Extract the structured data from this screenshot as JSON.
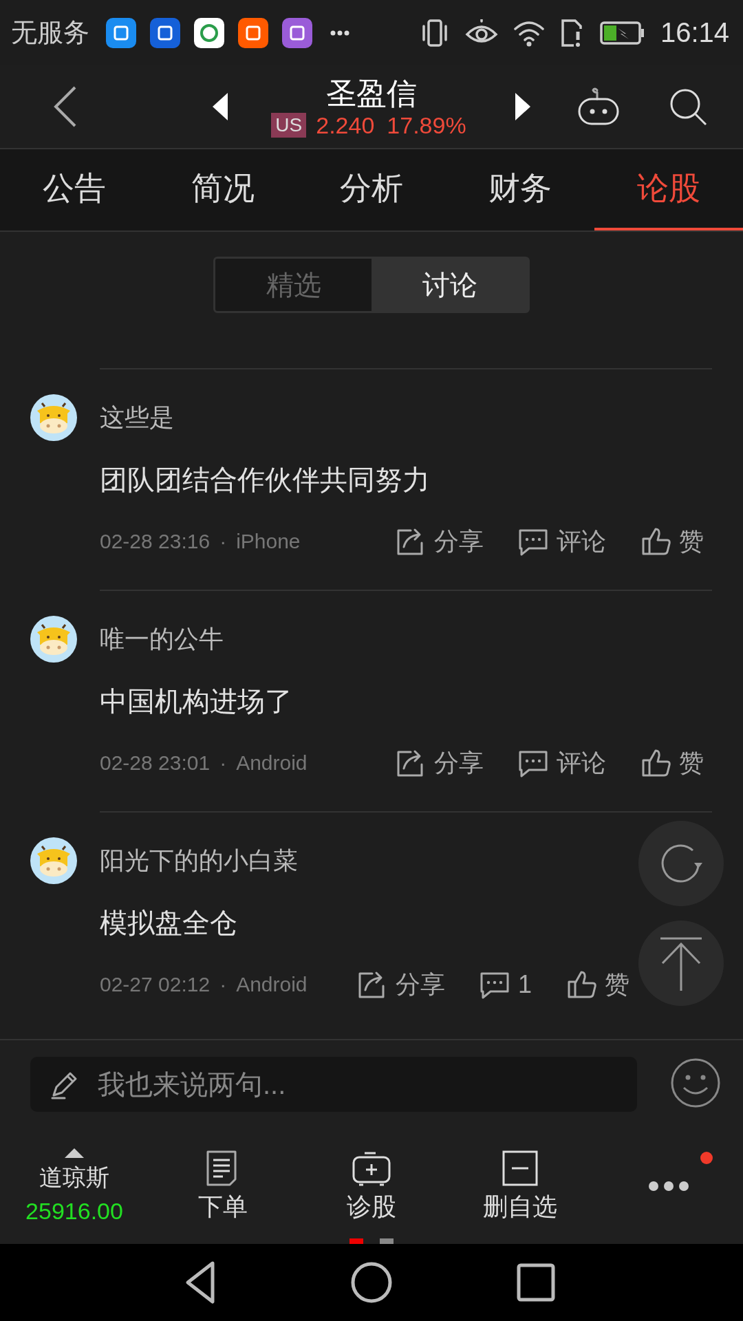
{
  "status_bar": {
    "carrier": "无服务",
    "notifications": [
      {
        "color": "#1a8cf0"
      },
      {
        "color": "#1560d8"
      },
      {
        "color": "#ffffff"
      },
      {
        "color": "#ff5a00"
      },
      {
        "color": "#9a5cd8"
      }
    ],
    "time": "16:14"
  },
  "header": {
    "title": "圣盈信",
    "market": "US",
    "price": "2.240",
    "change": "17.89%"
  },
  "tabs": [
    {
      "label": "公告",
      "selected": false
    },
    {
      "label": "简况",
      "selected": false
    },
    {
      "label": "分析",
      "selected": false
    },
    {
      "label": "财务",
      "selected": false
    },
    {
      "label": "论股",
      "selected": true
    }
  ],
  "segments": [
    {
      "label": "精选",
      "selected": false
    },
    {
      "label": "讨论",
      "selected": true
    }
  ],
  "comments": [
    {
      "user": "这些是",
      "text": "团队团结合作伙伴共同努力",
      "time": "02-28 23:16",
      "separator": "·",
      "device": "iPhone",
      "actions": [
        {
          "kind": "share",
          "label": "分享"
        },
        {
          "kind": "comment",
          "label": "评论"
        },
        {
          "kind": "like",
          "label": "赞"
        }
      ]
    },
    {
      "user": "唯一的公牛",
      "text": "中国机构进场了",
      "time": "02-28 23:01",
      "separator": "·",
      "device": "Android",
      "actions": [
        {
          "kind": "share",
          "label": "分享"
        },
        {
          "kind": "comment",
          "label": "评论"
        },
        {
          "kind": "like",
          "label": "赞"
        }
      ]
    },
    {
      "user": "阳光下的的小白菜",
      "text": "模拟盘全仓",
      "time": "02-27 02:12",
      "separator": "·",
      "device": "Android",
      "actions": [
        {
          "kind": "share",
          "label": "分享"
        },
        {
          "kind": "comment",
          "label": "1"
        },
        {
          "kind": "like",
          "label": "赞"
        }
      ]
    }
  ],
  "composer": {
    "placeholder": "我也来说两句..."
  },
  "index": {
    "name": "道琼斯",
    "value": "25916.00",
    "up": true
  },
  "toolbar": [
    {
      "kind": "order",
      "label": "下单"
    },
    {
      "kind": "diagnose",
      "label": "诊股"
    },
    {
      "kind": "remove",
      "label": "删自选"
    },
    {
      "kind": "more",
      "badge": true
    }
  ],
  "pager": [
    {
      "selected": true
    },
    {
      "selected": false
    }
  ]
}
